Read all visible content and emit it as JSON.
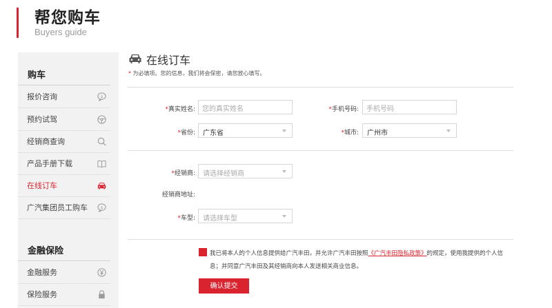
{
  "header": {
    "title": "帮您购车",
    "subtitle": "Buyers guide"
  },
  "sidebar": {
    "sections": [
      {
        "title": "购车",
        "items": [
          {
            "label": "报价咨询",
            "icon": "chat-bubble-icon"
          },
          {
            "label": "预约试驾",
            "icon": "steering-wheel-icon"
          },
          {
            "label": "经销商查询",
            "icon": "search-icon"
          },
          {
            "label": "产品手册下载",
            "icon": "book-icon"
          },
          {
            "label": "在线订车",
            "icon": "car-icon",
            "active": true
          },
          {
            "label": "广汽集团员工购车",
            "icon": "chat-bubble-icon"
          }
        ]
      },
      {
        "title": "金融保险",
        "items": [
          {
            "label": "金融服务",
            "icon": "yen-circle-icon"
          },
          {
            "label": "保险服务",
            "icon": "lock-icon"
          }
        ]
      }
    ]
  },
  "main": {
    "title": "在线订车",
    "note_star": "*",
    "note": "为必填项。您的信息，我们将会保密，请您放心填写。",
    "form": {
      "star": "*",
      "name_label": "真实姓名:",
      "name_placeholder": "您的真实姓名",
      "phone_label": "手机号码:",
      "phone_placeholder": "手机号码",
      "province_label": "省份:",
      "province_value": "广东省",
      "city_label": "城市:",
      "city_value": "广州市",
      "dealer_label": "经销商:",
      "dealer_placeholder": "请选择经销商",
      "dealer_address_label": "经销商地址:",
      "model_label": "车型:",
      "model_placeholder": "请选择车型"
    },
    "consent": {
      "text_before": "我已将本人的个人信息提供给广汽丰田，并允许广汽丰田按照",
      "link": "《广汽丰田隐私政策》",
      "text_after": "的规定，使用我提供的个人信息；并同意广汽丰田及其经销商向本人发送相关商业信息。"
    },
    "submit_label": "确认提交"
  },
  "colors": {
    "accent": "#d9242f",
    "sidebar_bg": "#f2f2f2"
  }
}
